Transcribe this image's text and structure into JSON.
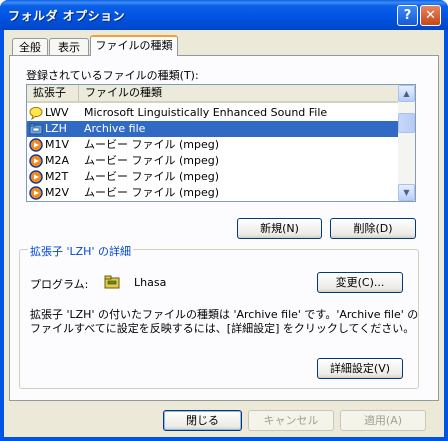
{
  "window": {
    "title": "フォルダ オプション",
    "help_glyph": "?",
    "close_glyph": "✕"
  },
  "tabs": [
    {
      "label": "全般",
      "active": false
    },
    {
      "label": "表示",
      "active": false
    },
    {
      "label": "ファイルの種類",
      "active": true
    }
  ],
  "file_types": {
    "label": "登録されているファイルの種類(T):",
    "columns": {
      "extension": "拡張子",
      "type": "ファイルの種類"
    },
    "rows": [
      {
        "ext": "LWV",
        "type": "Microsoft Linguistically Enhanced Sound File",
        "icon": "speech-bubble-icon",
        "selected": false
      },
      {
        "ext": "LZH",
        "type": "Archive file",
        "icon": "archive-folder-icon",
        "selected": true
      },
      {
        "ext": "M1V",
        "type": "ムービー ファイル (mpeg)",
        "icon": "media-player-icon",
        "selected": false
      },
      {
        "ext": "M2A",
        "type": "ムービー ファイル (mpeg)",
        "icon": "media-player-icon",
        "selected": false
      },
      {
        "ext": "M2T",
        "type": "ムービー ファイル (mpeg)",
        "icon": "media-player-icon",
        "selected": false
      },
      {
        "ext": "M2V",
        "type": "ムービー ファイル (mpeg)",
        "icon": "media-player-icon",
        "selected": false
      }
    ],
    "scroll_up": "▲",
    "scroll_down": "▼"
  },
  "buttons": {
    "new": "新規(N)",
    "delete": "削除(D)",
    "change": "変更(C)...",
    "advanced": "詳細設定(V)",
    "close": "閉じる",
    "cancel": "キャンセル",
    "apply": "適用(A)"
  },
  "details": {
    "title": "拡張子 'LZH' の詳細",
    "program_label": "プログラム:",
    "program_name": "Lhasa",
    "description_line1": "拡張子 'LZH' の付いたファイルの種類は 'Archive file' です。'Archive file' の",
    "description_line2": "ファイルすべてに設定を反映するには、[詳細設定] をクリックしてください。"
  },
  "colors": {
    "title_bar": "#0054e3",
    "selection": "#316ac5",
    "group_title": "#0046d5",
    "tab_highlight": "#f2a232"
  }
}
